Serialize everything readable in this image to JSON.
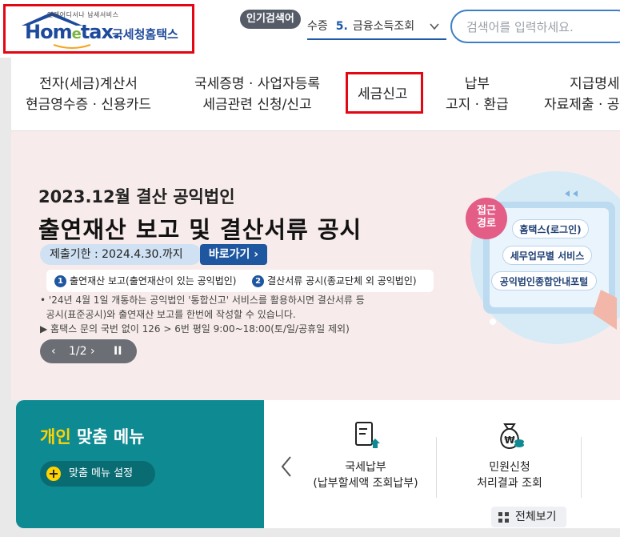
{
  "logo": {
    "sub": "언제어디서나 납세서비스",
    "main": "Hom",
    "main_e": "e",
    "main_tail": "tax.",
    "kr": "국세청홈택스"
  },
  "popular": {
    "badge": "인기검색어",
    "prefix": "수증",
    "rank": "5.",
    "keyword": "금융소득조회"
  },
  "search": {
    "placeholder": "검색어를 입력하세요."
  },
  "nav": {
    "items": [
      {
        "line1": "전자(세금)계산서",
        "line2": "현금영수증 · 신용카드"
      },
      {
        "line1": "국세증명 · 사업자등록",
        "line2": "세금관련 신청/신고"
      },
      {
        "line1": "세금신고",
        "line2": ""
      },
      {
        "line1": "납부",
        "line2": "고지 · 환급"
      },
      {
        "line1": "지급명세",
        "line2": "자료제출 · 공"
      }
    ]
  },
  "banner": {
    "subtitle": "2023.12월 결산 공익법인",
    "title": "출연재산 보고 및 결산서류 공시",
    "deadline": "제출기한 : 2024.4.30.까지",
    "goto": "바로가기 ›",
    "item1_num": "1",
    "item1": "출연재산 보고(출연재산이 있는 공익법인)",
    "item2_num": "2",
    "item2": "결산서류 공시(종교단체 외 공익법인)",
    "note1_l1": "• '24년 4월 1일 개통하는 공익법인 '통합신고' 서비스를 활용하시면 결산서류 등",
    "note1_l2": "  공시(표준공시)와 출연재산 보고를 한번에 작성할 수 있습니다.",
    "note2": "▶ 홈택스 문의 국번 없이 126 > 6번 평일 9:00~18:00(토/일/공휴일 제외)",
    "pager_prev": "‹",
    "pager_count": "1/2 ›",
    "pager_pause": "II",
    "access_badge_l1": "접근",
    "access_badge_l2": "경로",
    "path1": "홈택스(로그인)",
    "path2": "세무업무별 서비스",
    "path3": "공익법인종합안내포털"
  },
  "personal": {
    "title_hl": "개인",
    "title_rest": " 맞춤 메뉴",
    "setting_plus": "+",
    "setting": "맞춤 메뉴 설정"
  },
  "quick": {
    "items": [
      {
        "line1": "국세납부",
        "line2": "(납부할세액 조회납부)"
      },
      {
        "line1": "민원신청",
        "line2": "처리결과 조회"
      }
    ],
    "all_view": "전체보기"
  },
  "colors": {
    "brand_blue": "#1e4a9c",
    "highlight_red": "#e30613",
    "teal": "#0e8a92",
    "banner_bg": "#f7eceb",
    "yellow": "#ffd400"
  }
}
